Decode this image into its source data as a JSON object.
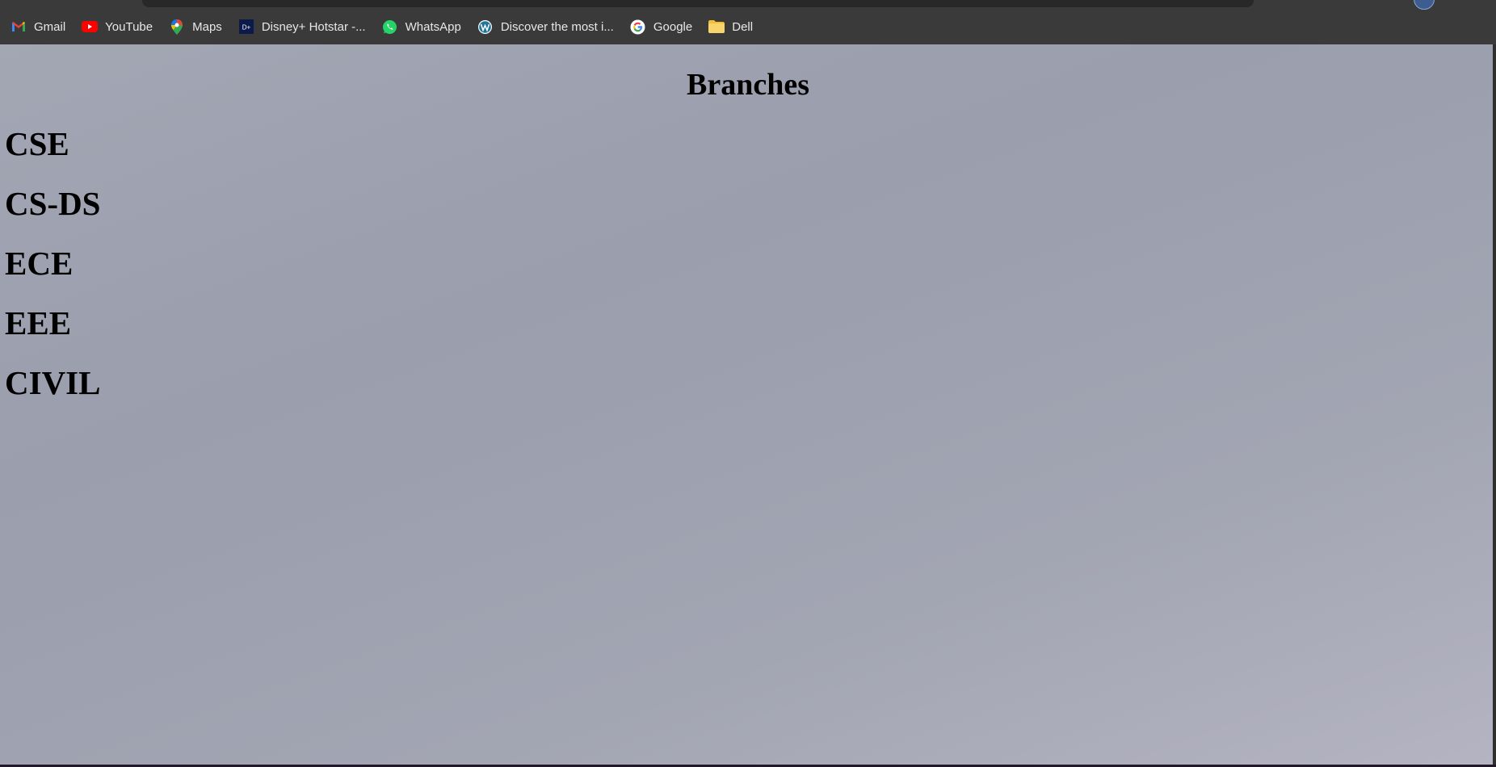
{
  "bookmarks": [
    {
      "label": "Gmail",
      "icon": "gmail-icon"
    },
    {
      "label": "YouTube",
      "icon": "youtube-icon"
    },
    {
      "label": "Maps",
      "icon": "maps-icon"
    },
    {
      "label": "Disney+ Hotstar -...",
      "icon": "hotstar-icon"
    },
    {
      "label": "WhatsApp",
      "icon": "whatsapp-icon"
    },
    {
      "label": "Discover the most i...",
      "icon": "wordpress-icon"
    },
    {
      "label": "Google",
      "icon": "google-icon"
    },
    {
      "label": "Dell",
      "icon": "folder-icon"
    }
  ],
  "page": {
    "title": "Branches",
    "branches": [
      "CSE",
      "CS-DS",
      "ECE",
      "EEE",
      "CIVIL"
    ]
  },
  "colors": {
    "browser_chrome": "#3a3a3a",
    "page_background": "#9ea1ad",
    "text": "#000000"
  }
}
